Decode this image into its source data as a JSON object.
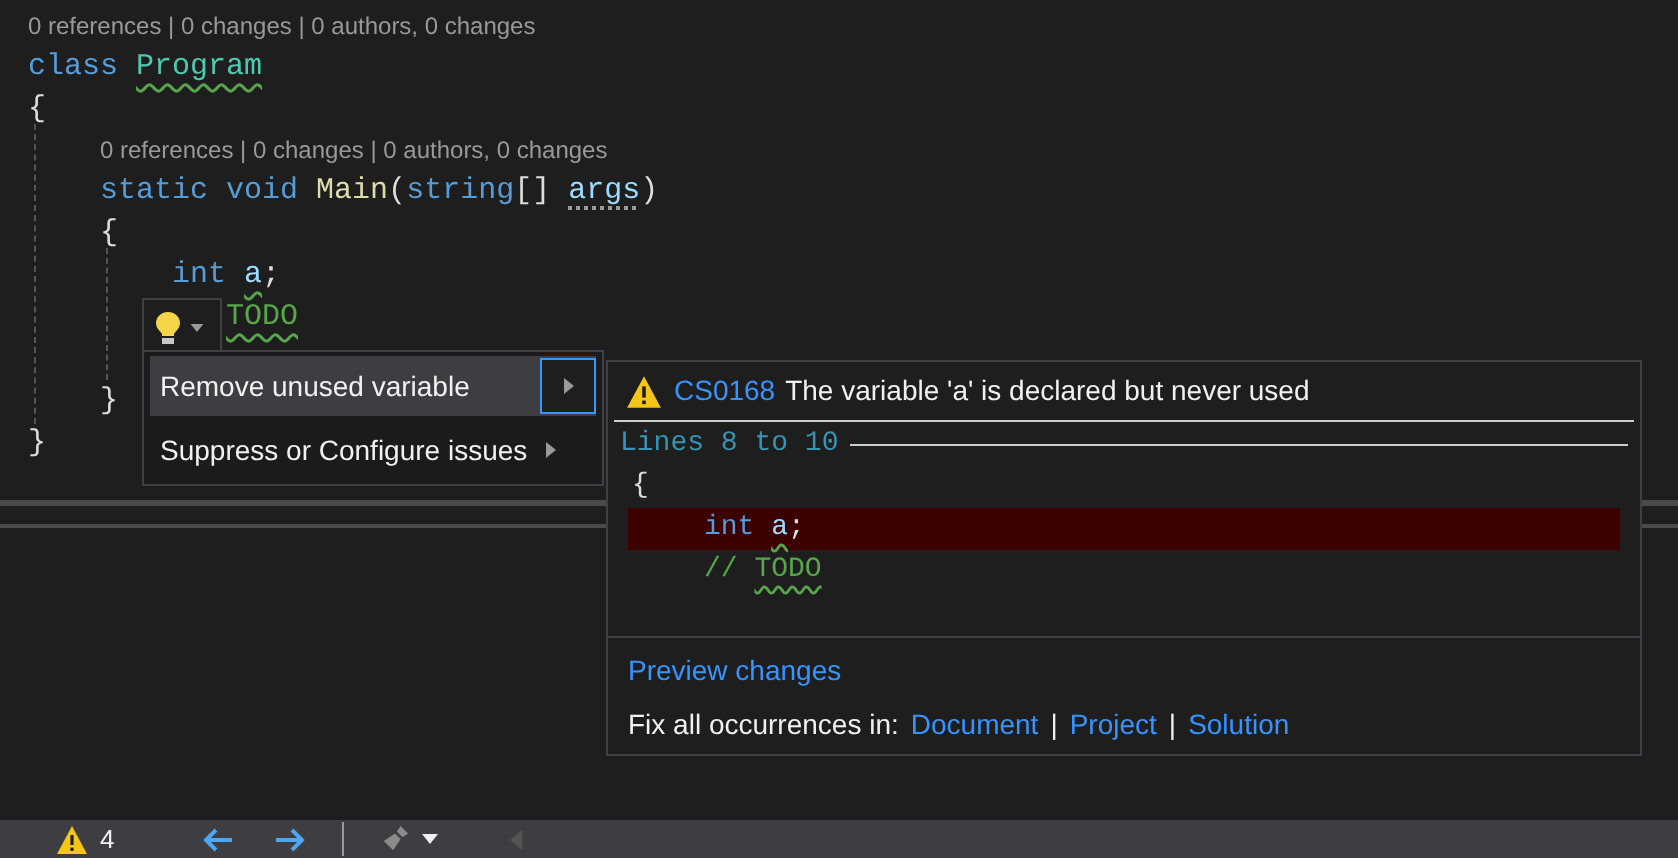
{
  "editor": {
    "lines": [
      {
        "codelens": "0 references | 0 changes | 0 authors, 0 changes",
        "tokens": [
          {
            "kind": "keyword",
            "text": "class "
          },
          {
            "kind": "type",
            "text": "Program",
            "wavy": true
          }
        ]
      },
      {
        "tokens": [
          {
            "kind": "plain",
            "text": "{"
          }
        ]
      },
      {
        "codelens": "0 references | 0 changes | 0 authors, 0 changes",
        "tokens": [
          {
            "kind": "keyword",
            "text": "    static void "
          },
          {
            "kind": "method",
            "text": "Main"
          },
          {
            "kind": "plain",
            "text": "("
          },
          {
            "kind": "keyword",
            "text": "string"
          },
          {
            "kind": "plain",
            "text": "[] "
          },
          {
            "kind": "ident",
            "text": "args",
            "dotted": true
          },
          {
            "kind": "plain",
            "text": ")"
          }
        ]
      },
      {
        "tokens": [
          {
            "kind": "plain",
            "text": "    {"
          }
        ]
      },
      {
        "tokens": [
          {
            "kind": "keyword",
            "text": "        int "
          },
          {
            "kind": "ident",
            "text": "a",
            "wavy": true
          },
          {
            "kind": "plain",
            "text": ";"
          }
        ]
      },
      {
        "lightbulb": true,
        "tokens": [
          {
            "kind": "comment",
            "text": "           TODO",
            "wavy": true
          }
        ]
      },
      {
        "tokens": [
          {
            "kind": "plain",
            "text": "    }"
          }
        ]
      },
      {
        "tokens": [
          {
            "kind": "plain",
            "text": "}"
          }
        ]
      }
    ]
  },
  "quick_actions": {
    "items": [
      {
        "label": "Remove unused variable",
        "selected": true,
        "submenu": true
      },
      {
        "label": "Suppress or Configure issues",
        "selected": false,
        "submenu": true
      }
    ]
  },
  "preview": {
    "code": "CS0168",
    "message": "The variable 'a' is declared but never used",
    "range": "Lines 8 to 10",
    "lines": [
      {
        "kind": "context",
        "tokens": [
          {
            "kind": "plain",
            "text": "{"
          }
        ]
      },
      {
        "kind": "removed",
        "tokens": [
          {
            "kind": "keyword",
            "text": "    int "
          },
          {
            "kind": "ident",
            "text": "a",
            "wavy": true
          },
          {
            "kind": "plain",
            "text": ";"
          }
        ]
      },
      {
        "kind": "context",
        "tokens": [
          {
            "kind": "comment",
            "text": "    // "
          },
          {
            "kind": "comment",
            "text": "TODO",
            "wavy": true
          }
        ]
      }
    ],
    "preview_link": "Preview changes",
    "fix_all_label": "Fix all occurrences in:",
    "scopes": [
      "Document",
      "Project",
      "Solution"
    ],
    "separator": "|"
  },
  "status_bar": {
    "warnings": "4"
  }
}
